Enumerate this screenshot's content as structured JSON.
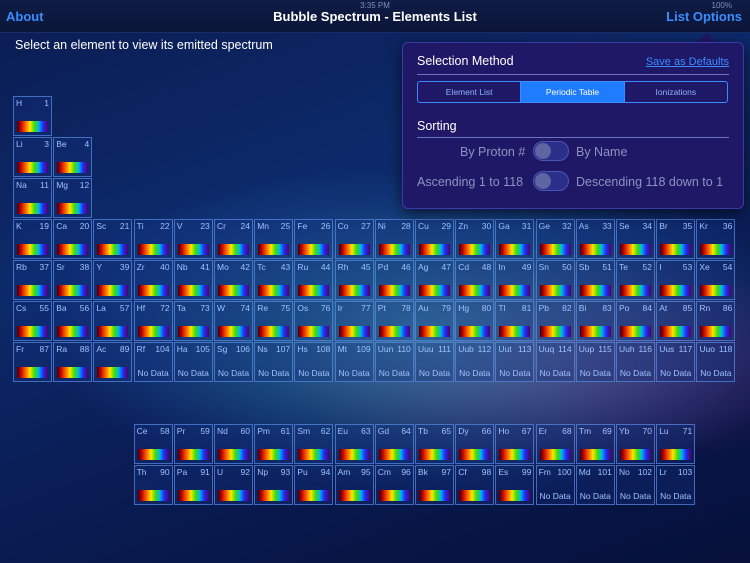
{
  "status_bar": {
    "time": "3:35 PM",
    "battery": "100%"
  },
  "nav": {
    "about": "About",
    "title": "Bubble Spectrum - Elements List",
    "list_options": "List Options"
  },
  "instruction": "Select an element to view its emitted spectrum",
  "no_data_label": "No Data",
  "elements": [
    {
      "s": "H",
      "n": 1,
      "row": 1,
      "col": 1
    },
    {
      "s": "Li",
      "n": 3,
      "row": 2,
      "col": 1
    },
    {
      "s": "Be",
      "n": 4,
      "row": 2,
      "col": 2
    },
    {
      "s": "Na",
      "n": 11,
      "row": 3,
      "col": 1
    },
    {
      "s": "Mg",
      "n": 12,
      "row": 3,
      "col": 2
    },
    {
      "s": "K",
      "n": 19,
      "row": 4,
      "col": 1
    },
    {
      "s": "Ca",
      "n": 20,
      "row": 4,
      "col": 2
    },
    {
      "s": "Sc",
      "n": 21,
      "row": 4,
      "col": 3
    },
    {
      "s": "Ti",
      "n": 22,
      "row": 4,
      "col": 4
    },
    {
      "s": "V",
      "n": 23,
      "row": 4,
      "col": 5
    },
    {
      "s": "Cr",
      "n": 24,
      "row": 4,
      "col": 6
    },
    {
      "s": "Mn",
      "n": 25,
      "row": 4,
      "col": 7
    },
    {
      "s": "Fe",
      "n": 26,
      "row": 4,
      "col": 8
    },
    {
      "s": "Co",
      "n": 27,
      "row": 4,
      "col": 9
    },
    {
      "s": "Ni",
      "n": 28,
      "row": 4,
      "col": 10
    },
    {
      "s": "Cu",
      "n": 29,
      "row": 4,
      "col": 11
    },
    {
      "s": "Zn",
      "n": 30,
      "row": 4,
      "col": 12
    },
    {
      "s": "Ga",
      "n": 31,
      "row": 4,
      "col": 13
    },
    {
      "s": "Ge",
      "n": 32,
      "row": 4,
      "col": 14
    },
    {
      "s": "As",
      "n": 33,
      "row": 4,
      "col": 15
    },
    {
      "s": "Se",
      "n": 34,
      "row": 4,
      "col": 16
    },
    {
      "s": "Br",
      "n": 35,
      "row": 4,
      "col": 17
    },
    {
      "s": "Kr",
      "n": 36,
      "row": 4,
      "col": 18
    },
    {
      "s": "Rb",
      "n": 37,
      "row": 5,
      "col": 1
    },
    {
      "s": "Sr",
      "n": 38,
      "row": 5,
      "col": 2
    },
    {
      "s": "Y",
      "n": 39,
      "row": 5,
      "col": 3
    },
    {
      "s": "Zr",
      "n": 40,
      "row": 5,
      "col": 4
    },
    {
      "s": "Nb",
      "n": 41,
      "row": 5,
      "col": 5
    },
    {
      "s": "Mo",
      "n": 42,
      "row": 5,
      "col": 6
    },
    {
      "s": "Tc",
      "n": 43,
      "row": 5,
      "col": 7
    },
    {
      "s": "Ru",
      "n": 44,
      "row": 5,
      "col": 8
    },
    {
      "s": "Rh",
      "n": 45,
      "row": 5,
      "col": 9
    },
    {
      "s": "Pd",
      "n": 46,
      "row": 5,
      "col": 10
    },
    {
      "s": "Ag",
      "n": 47,
      "row": 5,
      "col": 11
    },
    {
      "s": "Cd",
      "n": 48,
      "row": 5,
      "col": 12
    },
    {
      "s": "In",
      "n": 49,
      "row": 5,
      "col": 13
    },
    {
      "s": "Sn",
      "n": 50,
      "row": 5,
      "col": 14
    },
    {
      "s": "Sb",
      "n": 51,
      "row": 5,
      "col": 15
    },
    {
      "s": "Te",
      "n": 52,
      "row": 5,
      "col": 16
    },
    {
      "s": "I",
      "n": 53,
      "row": 5,
      "col": 17
    },
    {
      "s": "Xe",
      "n": 54,
      "row": 5,
      "col": 18
    },
    {
      "s": "Cs",
      "n": 55,
      "row": 6,
      "col": 1
    },
    {
      "s": "Ba",
      "n": 56,
      "row": 6,
      "col": 2
    },
    {
      "s": "La",
      "n": 57,
      "row": 6,
      "col": 3
    },
    {
      "s": "Hf",
      "n": 72,
      "row": 6,
      "col": 4
    },
    {
      "s": "Ta",
      "n": 73,
      "row": 6,
      "col": 5
    },
    {
      "s": "W",
      "n": 74,
      "row": 6,
      "col": 6
    },
    {
      "s": "Re",
      "n": 75,
      "row": 6,
      "col": 7
    },
    {
      "s": "Os",
      "n": 76,
      "row": 6,
      "col": 8
    },
    {
      "s": "Ir",
      "n": 77,
      "row": 6,
      "col": 9
    },
    {
      "s": "Pt",
      "n": 78,
      "row": 6,
      "col": 10
    },
    {
      "s": "Au",
      "n": 79,
      "row": 6,
      "col": 11
    },
    {
      "s": "Hg",
      "n": 80,
      "row": 6,
      "col": 12
    },
    {
      "s": "Tl",
      "n": 81,
      "row": 6,
      "col": 13
    },
    {
      "s": "Pb",
      "n": 82,
      "row": 6,
      "col": 14
    },
    {
      "s": "Bi",
      "n": 83,
      "row": 6,
      "col": 15
    },
    {
      "s": "Po",
      "n": 84,
      "row": 6,
      "col": 16
    },
    {
      "s": "At",
      "n": 85,
      "row": 6,
      "col": 17
    },
    {
      "s": "Rn",
      "n": 86,
      "row": 6,
      "col": 18
    },
    {
      "s": "Fr",
      "n": 87,
      "row": 7,
      "col": 1
    },
    {
      "s": "Ra",
      "n": 88,
      "row": 7,
      "col": 2
    },
    {
      "s": "Ac",
      "n": 89,
      "row": 7,
      "col": 3
    },
    {
      "s": "Rf",
      "n": 104,
      "row": 7,
      "col": 4,
      "nd": true
    },
    {
      "s": "Ha",
      "n": 105,
      "row": 7,
      "col": 5,
      "nd": true
    },
    {
      "s": "Sg",
      "n": 106,
      "row": 7,
      "col": 6,
      "nd": true
    },
    {
      "s": "Ns",
      "n": 107,
      "row": 7,
      "col": 7,
      "nd": true
    },
    {
      "s": "Hs",
      "n": 108,
      "row": 7,
      "col": 8,
      "nd": true
    },
    {
      "s": "Mt",
      "n": 109,
      "row": 7,
      "col": 9,
      "nd": true
    },
    {
      "s": "Uun",
      "n": 110,
      "row": 7,
      "col": 10,
      "nd": true
    },
    {
      "s": "Uuu",
      "n": 111,
      "row": 7,
      "col": 11,
      "nd": true
    },
    {
      "s": "Uub",
      "n": 112,
      "row": 7,
      "col": 12,
      "nd": true
    },
    {
      "s": "Uut",
      "n": 113,
      "row": 7,
      "col": 13,
      "nd": true
    },
    {
      "s": "Uuq",
      "n": 114,
      "row": 7,
      "col": 14,
      "nd": true
    },
    {
      "s": "Uup",
      "n": 115,
      "row": 7,
      "col": 15,
      "nd": true
    },
    {
      "s": "Uuh",
      "n": 116,
      "row": 7,
      "col": 16,
      "nd": true
    },
    {
      "s": "Uus",
      "n": 117,
      "row": 7,
      "col": 17,
      "nd": true
    },
    {
      "s": "Uuo",
      "n": 118,
      "row": 7,
      "col": 18,
      "nd": true
    },
    {
      "s": "Ce",
      "n": 58,
      "row": 9,
      "col": 4
    },
    {
      "s": "Pr",
      "n": 59,
      "row": 9,
      "col": 5
    },
    {
      "s": "Nd",
      "n": 60,
      "row": 9,
      "col": 6
    },
    {
      "s": "Pm",
      "n": 61,
      "row": 9,
      "col": 7
    },
    {
      "s": "Sm",
      "n": 62,
      "row": 9,
      "col": 8
    },
    {
      "s": "Eu",
      "n": 63,
      "row": 9,
      "col": 9
    },
    {
      "s": "Gd",
      "n": 64,
      "row": 9,
      "col": 10
    },
    {
      "s": "Tb",
      "n": 65,
      "row": 9,
      "col": 11
    },
    {
      "s": "Dy",
      "n": 66,
      "row": 9,
      "col": 12
    },
    {
      "s": "Ho",
      "n": 67,
      "row": 9,
      "col": 13
    },
    {
      "s": "Er",
      "n": 68,
      "row": 9,
      "col": 14
    },
    {
      "s": "Tm",
      "n": 69,
      "row": 9,
      "col": 15
    },
    {
      "s": "Yb",
      "n": 70,
      "row": 9,
      "col": 16
    },
    {
      "s": "Lu",
      "n": 71,
      "row": 9,
      "col": 17
    },
    {
      "s": "Th",
      "n": 90,
      "row": 10,
      "col": 4
    },
    {
      "s": "Pa",
      "n": 91,
      "row": 10,
      "col": 5
    },
    {
      "s": "U",
      "n": 92,
      "row": 10,
      "col": 6
    },
    {
      "s": "Np",
      "n": 93,
      "row": 10,
      "col": 7
    },
    {
      "s": "Pu",
      "n": 94,
      "row": 10,
      "col": 8
    },
    {
      "s": "Am",
      "n": 95,
      "row": 10,
      "col": 9
    },
    {
      "s": "Cm",
      "n": 96,
      "row": 10,
      "col": 10
    },
    {
      "s": "Bk",
      "n": 97,
      "row": 10,
      "col": 11
    },
    {
      "s": "Cf",
      "n": 98,
      "row": 10,
      "col": 12
    },
    {
      "s": "Es",
      "n": 99,
      "row": 10,
      "col": 13
    },
    {
      "s": "Fm",
      "n": 100,
      "row": 10,
      "col": 14,
      "nd": true
    },
    {
      "s": "Md",
      "n": 101,
      "row": 10,
      "col": 15,
      "nd": true
    },
    {
      "s": "No",
      "n": 102,
      "row": 10,
      "col": 16,
      "nd": true
    },
    {
      "s": "Lr",
      "n": 103,
      "row": 10,
      "col": 17,
      "nd": true
    }
  ],
  "popover": {
    "selection_method": "Selection Method",
    "save_defaults": "Save as Defaults",
    "segments": [
      {
        "label": "Element List",
        "active": false
      },
      {
        "label": "Periodic Table",
        "active": true
      },
      {
        "label": "Ionizations",
        "active": false
      }
    ],
    "sorting": "Sorting",
    "sort_by_proton": "By Proton #",
    "sort_by_name": "By Name",
    "order_ascending": "Ascending 1 to 118",
    "order_descending": "Descending 118 down to 1"
  }
}
